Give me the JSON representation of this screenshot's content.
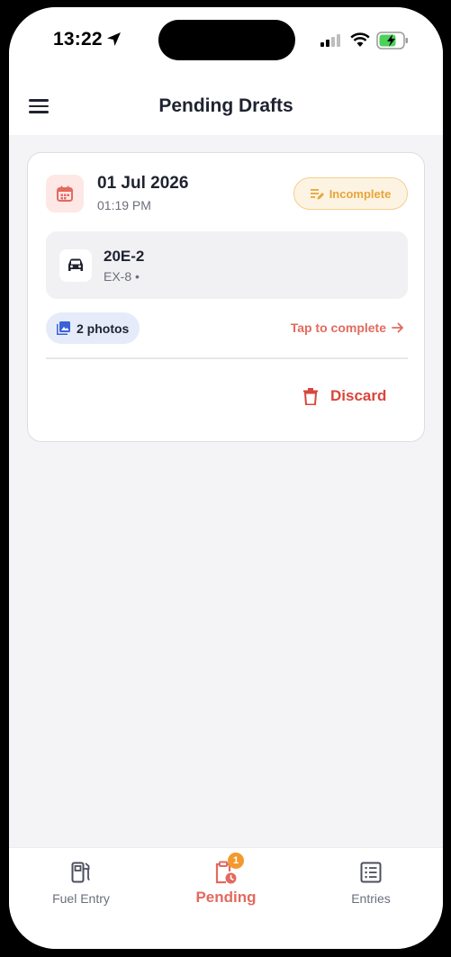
{
  "status_bar": {
    "time": "13:22"
  },
  "header": {
    "title": "Pending Drafts"
  },
  "draft": {
    "date": "01 Jul 2026",
    "time": "01:19 PM",
    "status_badge": "Incomplete",
    "vehicle_name": "20E-2",
    "vehicle_sub": "EX-8 •",
    "photos_label": "2 photos",
    "tap_label": "Tap to complete",
    "discard_label": "Discard"
  },
  "bottom_nav": {
    "items": [
      {
        "label": "Fuel Entry",
        "icon": "fuel-pump-icon"
      },
      {
        "label": "Pending",
        "icon": "clipboard-clock-icon",
        "badge": "1",
        "active": true
      },
      {
        "label": "Entries",
        "icon": "list-icon"
      }
    ]
  },
  "colors": {
    "accent": "#e26a5f",
    "danger": "#d9463b",
    "warning": "#e8a53a",
    "badge_orange": "#f29a2e",
    "background": "#f4f4f6"
  }
}
